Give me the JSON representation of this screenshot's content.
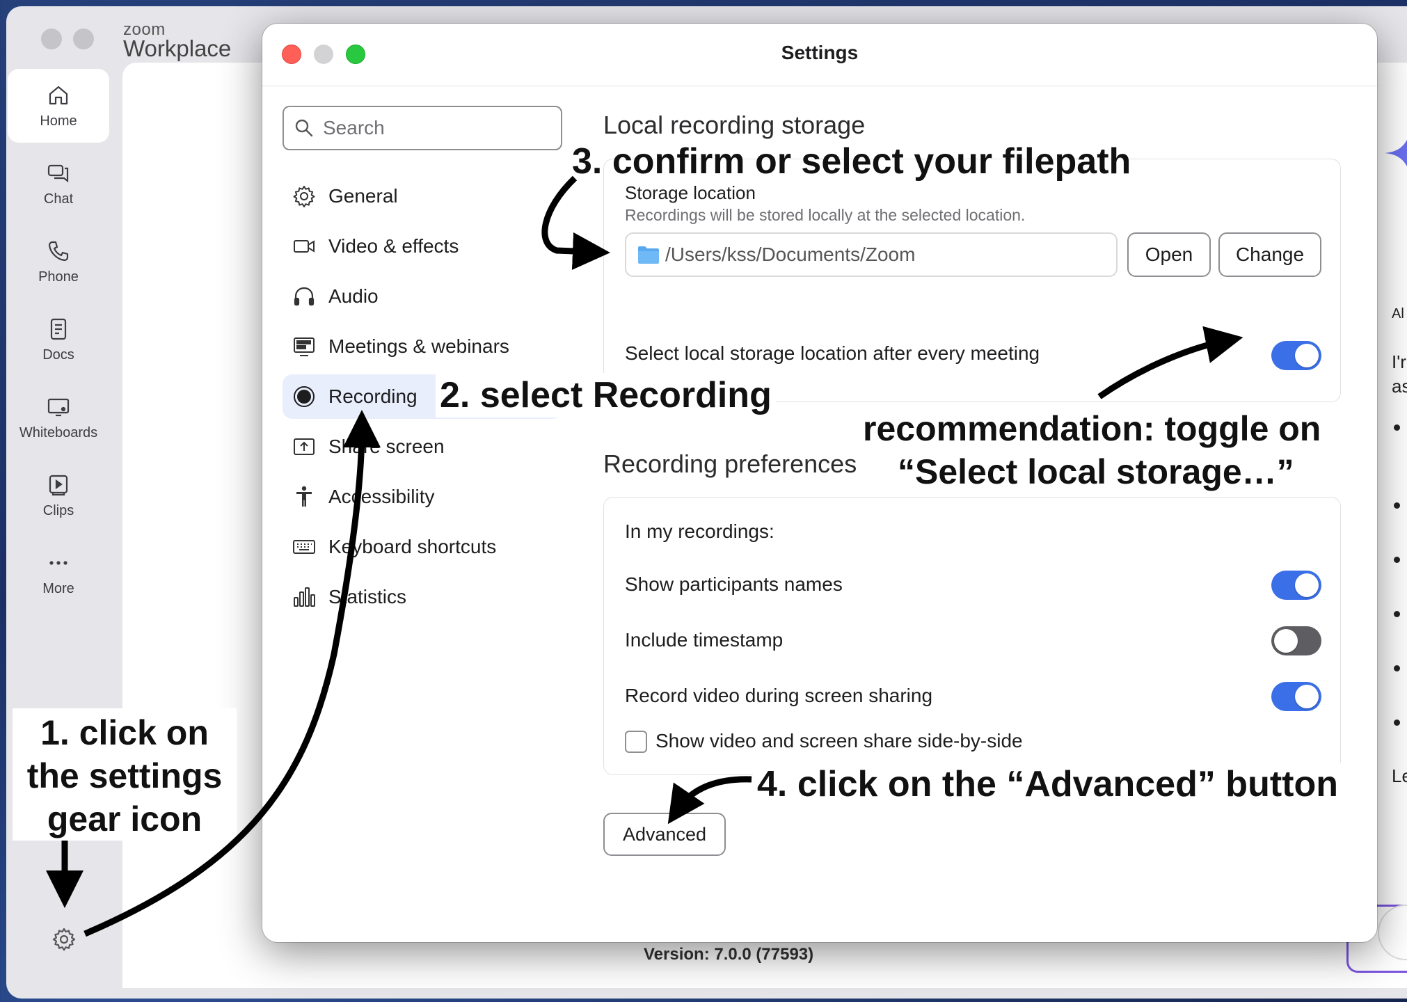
{
  "app": {
    "brand_small": "zoom",
    "brand_big": "Workplace",
    "rail": [
      {
        "label": "Home",
        "icon": "home-icon"
      },
      {
        "label": "Chat",
        "icon": "chat-icon"
      },
      {
        "label": "Phone",
        "icon": "phone-icon"
      },
      {
        "label": "Docs",
        "icon": "docs-icon"
      },
      {
        "label": "Whiteboards",
        "icon": "whiteboard-icon"
      },
      {
        "label": "Clips",
        "icon": "clips-icon"
      },
      {
        "label": "More",
        "icon": "more-icon"
      }
    ],
    "version": "Version: 7.0.0 (77593)",
    "right_panel_chars": {
      "line1": "Al",
      "line2": "I'r",
      "line3": "as",
      "line4": "Le"
    }
  },
  "settings": {
    "title": "Settings",
    "search_placeholder": "Search",
    "nav": [
      {
        "label": "General",
        "icon": "gear-icon"
      },
      {
        "label": "Video & effects",
        "icon": "video-icon"
      },
      {
        "label": "Audio",
        "icon": "headphones-icon"
      },
      {
        "label": "Meetings & webinars",
        "icon": "meetings-icon"
      },
      {
        "label": "Recording",
        "icon": "record-icon",
        "selected": true
      },
      {
        "label": "Share screen",
        "icon": "share-screen-icon"
      },
      {
        "label": "Accessibility",
        "icon": "accessibility-icon"
      },
      {
        "label": "Keyboard shortcuts",
        "icon": "keyboard-icon"
      },
      {
        "label": "Statistics",
        "icon": "statistics-icon"
      }
    ],
    "local_storage": {
      "section_title": "Local recording storage",
      "storage_label": "Storage location",
      "storage_desc": "Recordings will be stored locally at the selected location.",
      "path": "/Users/kss/Documents/Zoom",
      "open_label": "Open",
      "change_label": "Change",
      "select_after_label": "Select local storage location after every meeting",
      "select_after_on": true
    },
    "preferences": {
      "section_title": "Recording preferences",
      "group_label": "In my recordings:",
      "items": [
        {
          "label": "Show participants names",
          "on": true
        },
        {
          "label": "Include timestamp",
          "on": false
        },
        {
          "label": "Record video during screen sharing",
          "on": true
        }
      ],
      "checkbox_label": "Show video and screen share side-by-side",
      "checkbox_checked": false,
      "advanced_label": "Advanced"
    }
  },
  "annotations": {
    "step1_line1": "1. click on",
    "step1_line2": "the settings",
    "step1_line3": "gear icon",
    "step2": "2. select Recording",
    "step3": "3. confirm or select your filepath",
    "rec_line1": "recommendation: toggle on",
    "rec_line2": "“Select local storage…”",
    "step4": "4. click on the “Advanced” button"
  },
  "colors": {
    "accent": "#3b6fe8",
    "toggle_off": "#5e5e62",
    "close": "#fe5f57",
    "zoom_green": "#28c840"
  }
}
